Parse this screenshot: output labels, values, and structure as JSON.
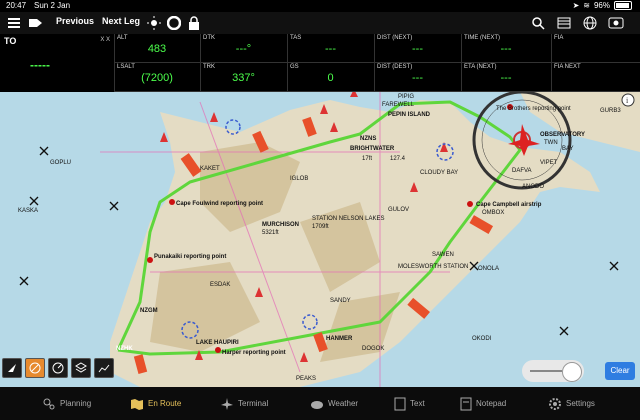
{
  "status": {
    "time": "20:47",
    "date": "Sun 2 Jan",
    "battery": "96%",
    "battery_level": 0.96
  },
  "toolbar": {
    "previous": "Previous",
    "next": "Next Leg"
  },
  "instruments": {
    "to_label": "TO",
    "to_xx": "X X",
    "to_value": "-----",
    "cells": [
      {
        "label": "ALT",
        "value": "483"
      },
      {
        "label": "DTK",
        "value": "---°"
      },
      {
        "label": "TAS",
        "value": "---"
      },
      {
        "label": "DIST (NEXT)",
        "value": "---"
      },
      {
        "label": "TIME (NEXT)",
        "value": "---"
      },
      {
        "label": "FIA",
        "value": ""
      },
      {
        "label": "LSALT",
        "value": "(7200)"
      },
      {
        "label": "TRK",
        "value": "337°"
      },
      {
        "label": "GS",
        "value": "0"
      },
      {
        "label": "DIST (DEST)",
        "value": "---"
      },
      {
        "label": "ETA (NEXT)",
        "value": "---"
      },
      {
        "label": "FIA NEXT",
        "value": ""
      }
    ]
  },
  "map": {
    "labels": {
      "pipig": "PIPIG",
      "fairewell": "FAREWELL",
      "pepin": "PEPIN ISLAND",
      "nzns": "NZNS",
      "brightwater": "BRIGHTWATER",
      "brothers": "The Brothers reporting point",
      "observatory": "OBSERVATORY",
      "twn": "TWN",
      "bay": "BAY",
      "cloudy": "CLOUDY BAY",
      "foulwind": "Cape Foulwind reporting point",
      "murchison": "MURCHISON",
      "station_nl": "STATION NELSON LAKES",
      "nl_alt": "1709ft",
      "murch_alt": "5321ft",
      "cape_campbell": "Cape Campbell airstrip",
      "punakaiki": "Punakaiki reporting point",
      "nzgm": "NZGM",
      "nzhk": "NZHK",
      "lake_haupiri": "LAKE HAUPIRI",
      "harper": "Harper reporting point",
      "hanmer": "HANMER",
      "molesworth": "MOLESWORTH STATION",
      "gulov": "GULOV",
      "kaket": "KAKET",
      "iglob": "IGLOB",
      "gopu": "GOPLU",
      "kaska": "KASKA",
      "esdak": "ESDAK",
      "sandy": "SANDY",
      "onola": "ONOLA",
      "okodi": "OKODI",
      "dogok": "DOGOK",
      "peaks": "PEAKS",
      "vipet": "VIPET",
      "anodo": "ANODO",
      "dafva": "DAFVA",
      "sawen": "SAWEN",
      "ombox": "OMBOX",
      "gurb": "GURB3",
      "brightwater_alt": "17ft",
      "brightwater_freq": "127.4"
    }
  },
  "tabs": [
    "Planning",
    "En Route",
    "Terminal",
    "Weather",
    "Text",
    "Notepad",
    "Settings"
  ],
  "controls": {
    "clear": "Clear"
  },
  "colors": {
    "route": "#5fd63c",
    "water": "#b6d9e7",
    "land": "#e4dcc4",
    "accent": "#e6c15a"
  }
}
